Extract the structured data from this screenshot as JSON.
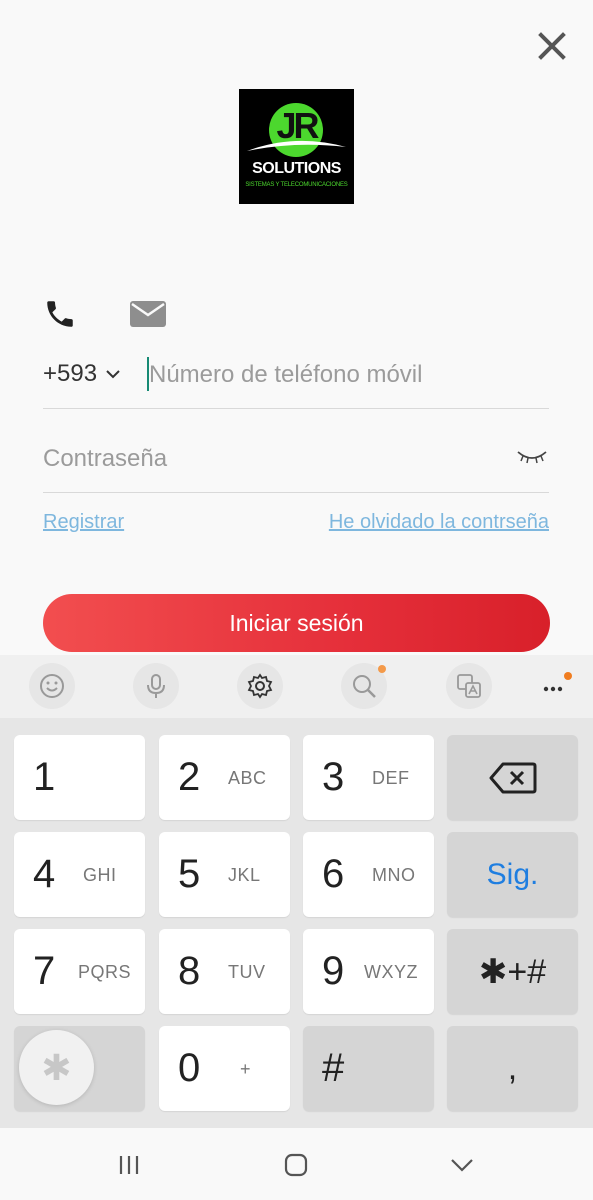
{
  "logo": {
    "mark": "JR",
    "name": "SOLUTIONS",
    "tagline": "SISTEMAS Y TELECOMUNICACIONES"
  },
  "icons": {
    "close": "close-icon",
    "phone": "phone-icon",
    "mail": "mail-icon",
    "eye": "eye-closed-icon",
    "chevron": "chevron-down-icon"
  },
  "form": {
    "country_code": "+593",
    "phone_placeholder": "Número de teléfono móvil",
    "password_placeholder": "Contraseña",
    "register_link": "Registrar",
    "forgot_link": "He olvidado la contrseña",
    "login_button": "Iniciar sesión"
  },
  "colors": {
    "accent_red": "#e52f3a",
    "link_blue": "#7eb7de",
    "logo_green": "#4cd82e",
    "caret_teal": "#178a74"
  },
  "keyboard": {
    "toolbar": [
      "emoji-icon",
      "microphone-icon",
      "settings-icon",
      "search-icon",
      "translate-icon",
      "more-icon"
    ],
    "keys": [
      {
        "num": "1",
        "sub": ""
      },
      {
        "num": "2",
        "sub": "ABC"
      },
      {
        "num": "3",
        "sub": "DEF"
      },
      {
        "num": "4",
        "sub": "GHI"
      },
      {
        "num": "5",
        "sub": "JKL"
      },
      {
        "num": "6",
        "sub": "MNO"
      },
      {
        "num": "7",
        "sub": "PQRS"
      },
      {
        "num": "8",
        "sub": "TUV"
      },
      {
        "num": "9",
        "sub": "WXYZ"
      },
      {
        "num": "0",
        "sub": "+"
      },
      {
        "num": "#",
        "sub": ""
      }
    ],
    "next_label": "Sig.",
    "symbols_label": "✱+#",
    "comma_label": ",",
    "star_label": "✱"
  },
  "navbar": [
    "recents-icon",
    "home-icon",
    "back-icon"
  ]
}
